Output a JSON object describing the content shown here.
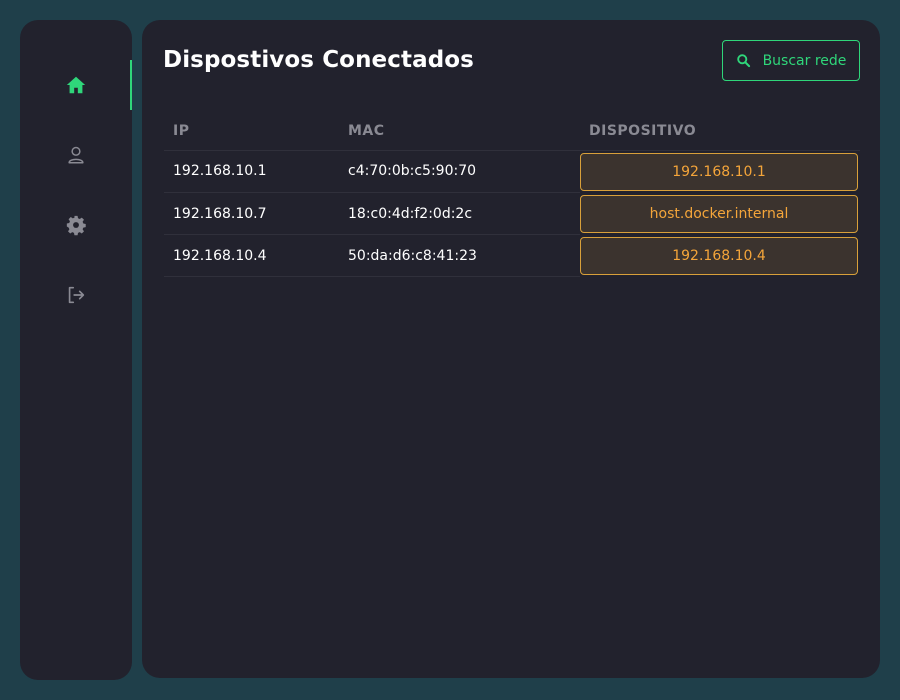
{
  "page": {
    "title": "Dispostivos Conectados"
  },
  "toolbar": {
    "scan_label": "Buscar rede",
    "scan_icon": "search-icon"
  },
  "sidebar": {
    "items": [
      {
        "icon": "home-icon",
        "active": true
      },
      {
        "icon": "user-icon",
        "active": false
      },
      {
        "icon": "gear-icon",
        "active": false
      },
      {
        "icon": "logout-icon",
        "active": false
      }
    ]
  },
  "colors": {
    "accent": "#2fd67a",
    "device": "#f4a53a",
    "panel": "#22222d",
    "background": "#1f3f4a"
  },
  "table": {
    "headers": {
      "ip": "IP",
      "mac": "MAC",
      "device": "DISPOSITIVO"
    },
    "rows": [
      {
        "ip": "192.168.10.1",
        "mac": "c4:70:0b:c5:90:70",
        "device": "192.168.10.1"
      },
      {
        "ip": "192.168.10.7",
        "mac": "18:c0:4d:f2:0d:2c",
        "device": "host.docker.internal"
      },
      {
        "ip": "192.168.10.4",
        "mac": "50:da:d6:c8:41:23",
        "device": "192.168.10.4"
      }
    ]
  }
}
